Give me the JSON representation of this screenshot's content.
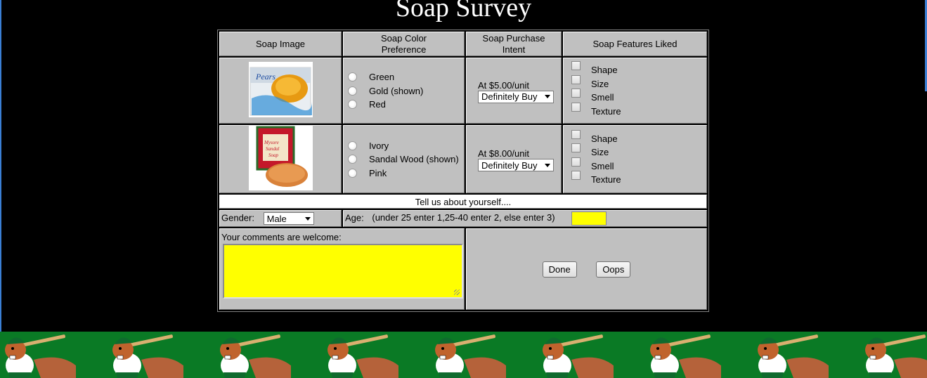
{
  "title": "Soap Survey",
  "headers": {
    "image": "Soap Image",
    "color_line1": "Soap Color",
    "color_line2": "Preference",
    "intent_line1": "Soap Purchase",
    "intent_line2": "Intent",
    "features": "Soap Features Liked"
  },
  "products": [
    {
      "logo": "Pears",
      "colors": [
        "Green",
        "Gold (shown)",
        "Red"
      ],
      "price": "At $5.00/unit",
      "intent": "Definitely Buy",
      "features": [
        "Shape",
        "Size",
        "Smell",
        "Texture"
      ]
    },
    {
      "logo": "Mysore Sandal Soap",
      "colors": [
        "Ivory",
        "Sandal Wood (shown)",
        "Pink"
      ],
      "price": "At $8.00/unit",
      "intent": "Definitely Buy",
      "features": [
        "Shape",
        "Size",
        "Smell",
        "Texture"
      ]
    }
  ],
  "about": "Tell us about yourself....",
  "gender": {
    "label": "Gender:",
    "value": "Male"
  },
  "age": {
    "label": "Age:",
    "hint": "(under 25 enter 1,25-40 enter 2, else enter 3)",
    "value": ""
  },
  "comments": {
    "label": "Your comments are welcome:",
    "value": ""
  },
  "buttons": {
    "done": "Done",
    "oops": "Oops"
  },
  "colors": {
    "background": "#000000",
    "cell": "#c0c0c0",
    "input_highlight": "#ffff00",
    "banner": "#0a7a25"
  }
}
